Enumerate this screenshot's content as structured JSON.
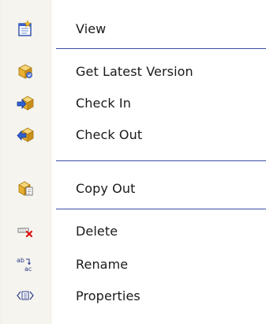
{
  "menu": {
    "items": [
      {
        "label": "View",
        "icon": "view-document-icon"
      },
      {
        "label": "Get Latest Version",
        "icon": "get-latest-box-icon"
      },
      {
        "label": "Check In",
        "icon": "check-in-box-icon"
      },
      {
        "label": "Check Out",
        "icon": "check-out-box-icon"
      },
      {
        "label": "Copy Out",
        "icon": "copy-out-box-icon"
      },
      {
        "label": "Delete",
        "icon": "delete-x-icon"
      },
      {
        "label": "Rename",
        "icon": "rename-abc-icon"
      },
      {
        "label": "Properties",
        "icon": "properties-icon"
      }
    ]
  },
  "colors": {
    "separator": "#3b4fa3",
    "gutter": "#f5f4ee",
    "text": "#1a1a1a",
    "delete_x": "#e01010",
    "box_gold": "#e8b030",
    "arrow_blue": "#2f5fd0"
  }
}
